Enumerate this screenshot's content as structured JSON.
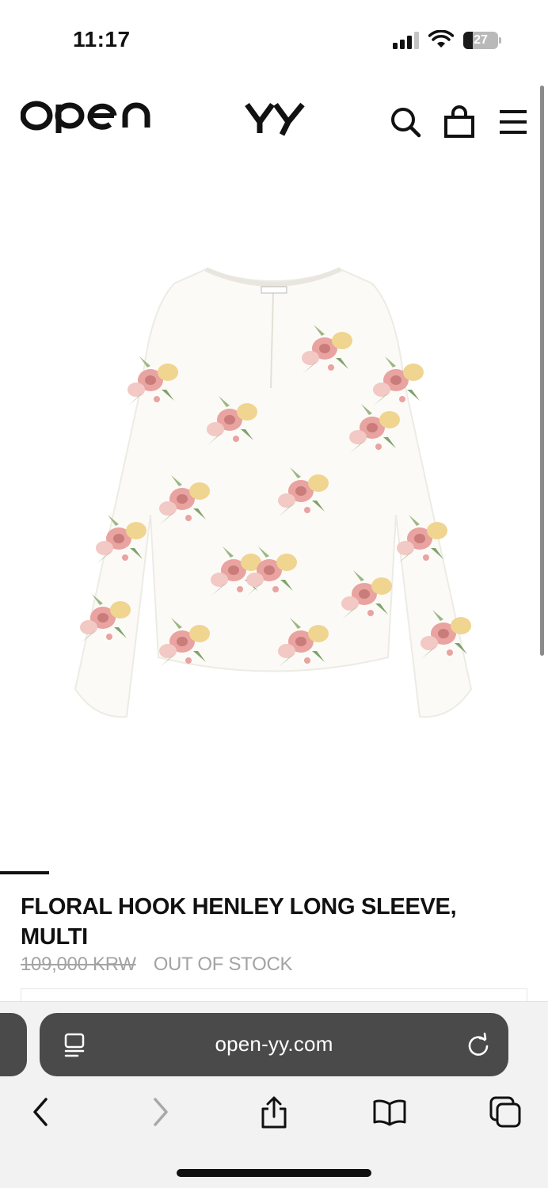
{
  "status_bar": {
    "time": "11:17",
    "battery_level": "27",
    "battery_fraction": 0.27
  },
  "header": {
    "logo_left": "OPEN",
    "logo_right": "YY",
    "icons": [
      "search-icon",
      "shopping-bag-icon",
      "menu-icon"
    ]
  },
  "product": {
    "title": "FLORAL HOOK HENLEY LONG SLEEVE, MULTI",
    "old_price": "109,000 KRW",
    "stock_status": "OUT OF STOCK",
    "image_description_colors": {
      "fabric": "#fbfaf6",
      "flower_pink": "#e9a3a0",
      "flower_yellow": "#f0d590",
      "leaf_green": "#7fa36a"
    },
    "gallery_progress": 0.09
  },
  "browser": {
    "url": "open-yy.com",
    "toolbar_icons": [
      "back-icon",
      "forward-icon",
      "share-icon",
      "bookmarks-icon",
      "tabs-icon"
    ]
  }
}
